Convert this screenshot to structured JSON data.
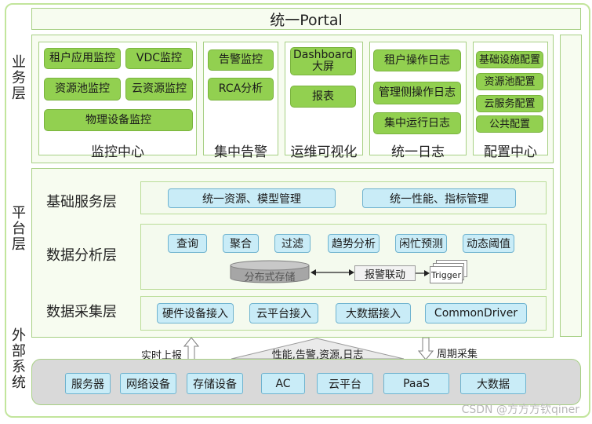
{
  "portal": {
    "title": "统一Portal"
  },
  "side_labels": {
    "business": "业务层",
    "platform": "平台层",
    "external": "外部系统"
  },
  "business": {
    "monitor": {
      "title": "监控中心",
      "items": [
        "租户应用监控",
        "VDC监控",
        "资源池监控",
        "云资源监控",
        "物理设备监控"
      ]
    },
    "alarm": {
      "title": "集中告警",
      "items": [
        "告警监控",
        "RCA分析"
      ]
    },
    "visual": {
      "title": "运维可视化",
      "items": [
        "Dashboard大屏",
        "报表"
      ]
    },
    "log": {
      "title": "统一日志",
      "items": [
        "租户操作日志",
        "管理侧操作日志",
        "集中运行日志"
      ]
    },
    "config": {
      "title": "配置中心",
      "items": [
        "基础设施配置",
        "资源池配置",
        "云服务配置",
        "公共配置"
      ]
    }
  },
  "platform": {
    "base": {
      "title": "基础服务层",
      "items": [
        "统一资源、模型管理",
        "统一性能、指标管理"
      ]
    },
    "analysis": {
      "title": "数据分析层",
      "items": [
        "查询",
        "聚合",
        "过滤",
        "趋势分析",
        "闲忙预测",
        "动态阈值"
      ],
      "storage": "分布式存储",
      "linkage": "报警联动",
      "trigger": "Trigger"
    },
    "collect": {
      "title": "数据采集层",
      "items": [
        "硬件设备接入",
        "云平台接入",
        "大数据接入",
        "CommonDriver"
      ]
    }
  },
  "flows": {
    "realtime": "实时上报",
    "middle": "性能,告警,资源,日志",
    "periodic": "周期采集"
  },
  "external": {
    "items": [
      "服务器",
      "网络设备",
      "存储设备",
      "AC",
      "云平台",
      "PaaS",
      "大数据"
    ]
  },
  "watermark": "CSDN @方方方钦qiner"
}
